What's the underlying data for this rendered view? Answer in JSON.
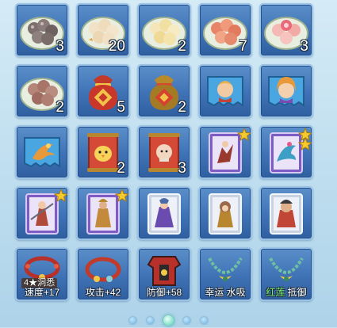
{
  "inventory": {
    "rows": [
      [
        {
          "item": "grey-dumpling-plate-icon",
          "count": "3"
        },
        {
          "item": "cream-dumpling-plate-icon",
          "count": "20"
        },
        {
          "item": "yellow-dumpling-plate-icon",
          "count": "2"
        },
        {
          "item": "red-dumpling-plate-icon",
          "count": "7"
        },
        {
          "item": "flower-dumpling-plate-icon",
          "count": "3"
        }
      ],
      [
        {
          "item": "brown-dumpling-plate-icon",
          "count": "2"
        },
        {
          "item": "red-lucky-bag-icon",
          "count": "5"
        },
        {
          "item": "gold-lucky-bag-icon",
          "count": "2"
        },
        {
          "item": "blue-hero-card-icon",
          "count": ""
        },
        {
          "item": "blue-heroine-card-icon",
          "count": ""
        }
      ],
      [
        {
          "item": "blue-phoenix-card-icon",
          "count": ""
        },
        {
          "item": "chick-scroll-icon",
          "count": "2"
        },
        {
          "item": "monk-scroll-icon",
          "count": "3"
        },
        {
          "item": "purple-warrior-card-icon",
          "count": "",
          "stars": 1
        },
        {
          "item": "purple-dragon-card-icon",
          "count": "",
          "stars": 2
        }
      ],
      [
        {
          "item": "purple-swordsman-card-icon",
          "count": "",
          "stars": 1
        },
        {
          "item": "purple-general-card-icon",
          "count": "",
          "stars": 1
        },
        {
          "item": "silver-knight-card-icon",
          "count": ""
        },
        {
          "item": "silver-monkey-card-icon",
          "count": ""
        },
        {
          "item": "silver-ogre-card-icon",
          "count": ""
        }
      ],
      [
        {
          "item": "red-bead-bracelet-icon",
          "tag": "4★洞悉",
          "stat": "速度+17"
        },
        {
          "item": "red-bell-bracelet-icon",
          "stat": "攻击+42"
        },
        {
          "item": "red-armor-icon",
          "stat": "防御+58"
        },
        {
          "item": "jade-necklace-icon",
          "stat": "幸运 水吸"
        },
        {
          "item": "jade-pendant-necklace-icon",
          "stat_green": "红莲",
          "stat": "抵御"
        }
      ]
    ]
  },
  "pagination": {
    "pages": 5,
    "current": 3
  }
}
